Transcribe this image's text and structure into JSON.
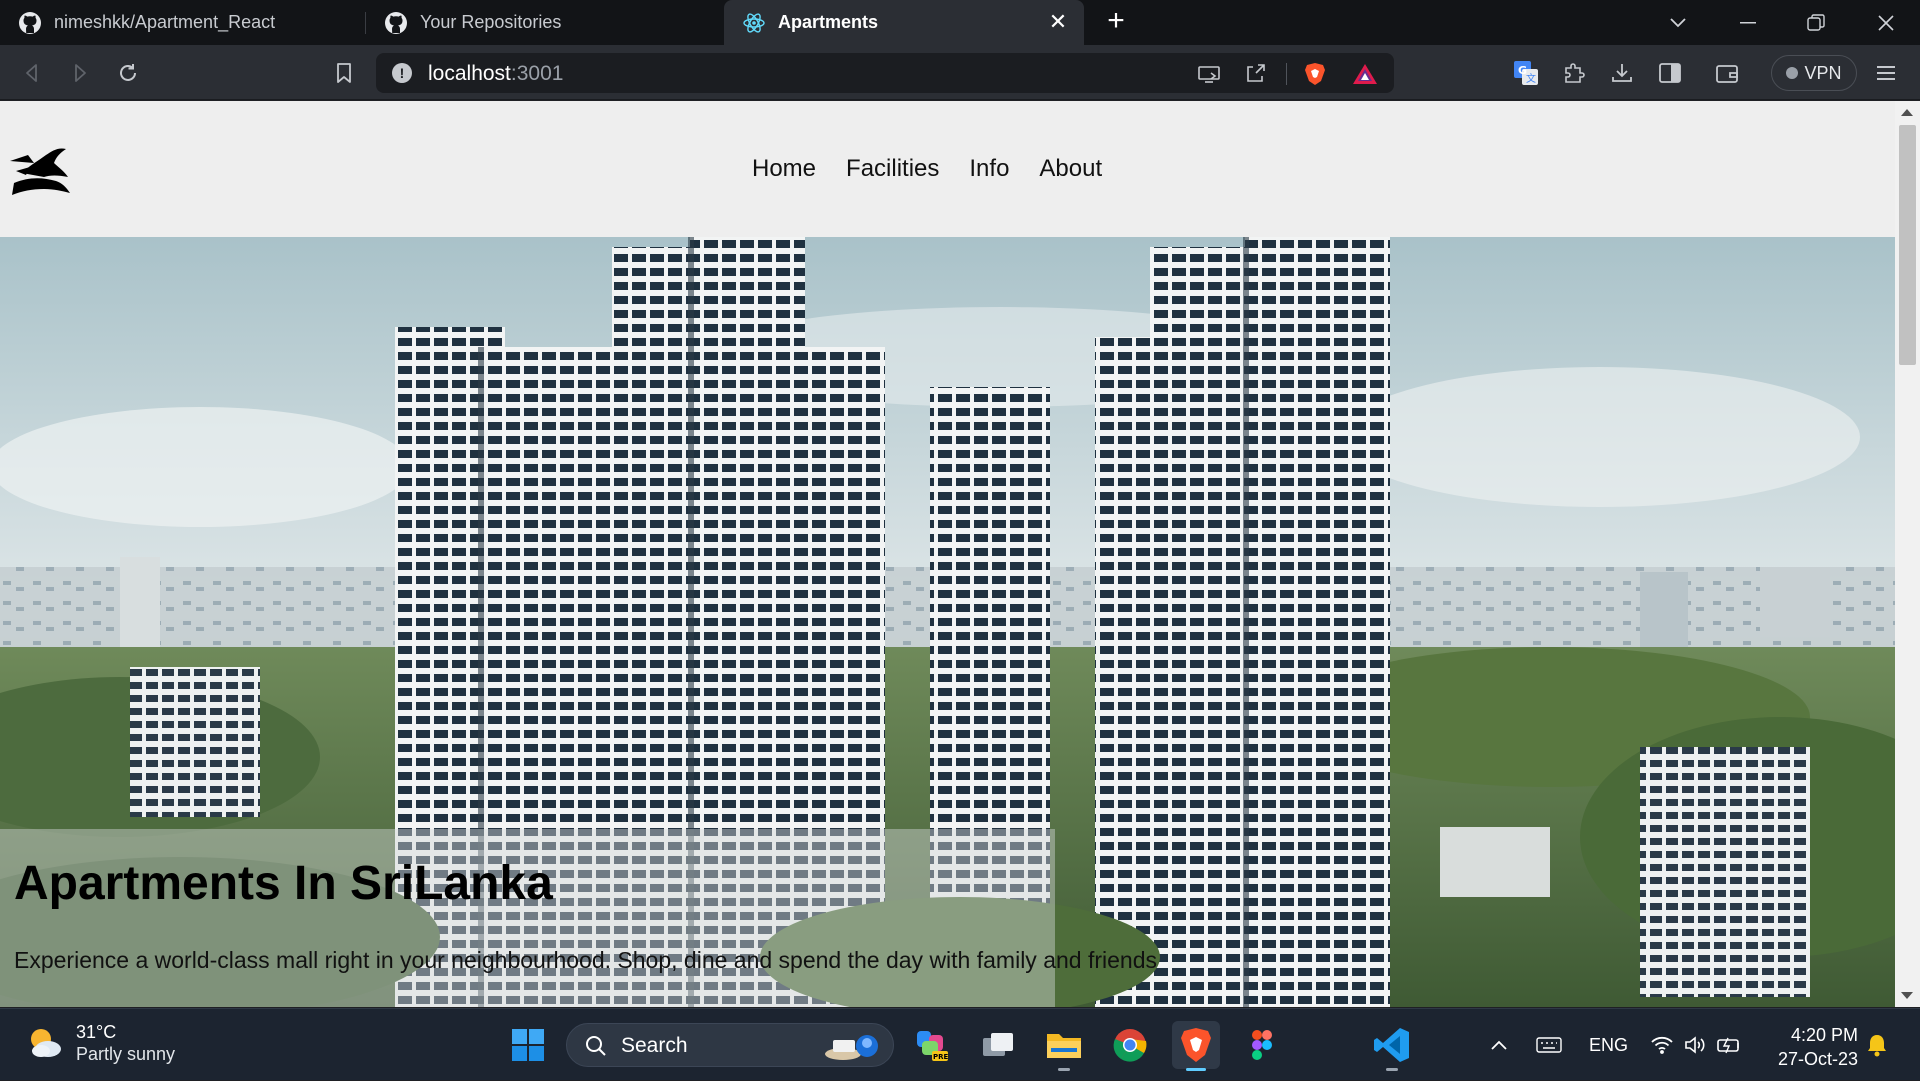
{
  "browser": {
    "tabs": [
      {
        "title": "nimeshkk/Apartment_React",
        "icon": "github-icon",
        "active": false
      },
      {
        "title": "Your Repositories",
        "icon": "github-icon",
        "active": false
      },
      {
        "title": "Apartments",
        "icon": "react-icon",
        "active": true
      }
    ],
    "url_host": "localhost",
    "url_port": ":3001",
    "vpn_label": "VPN"
  },
  "page": {
    "nav": [
      "Home",
      "Facilities",
      "Info",
      "About"
    ],
    "hero": {
      "title": "Apartments In SriLanka",
      "text": "Experience a world-class mall right in your neighbourhood. Shop, dine and spend the day with family and friends"
    }
  },
  "taskbar": {
    "weather_temp": "31°C",
    "weather_desc": "Partly sunny",
    "search_label": "Search",
    "language": "ENG",
    "time": "4:20 PM",
    "date": "27-Oct-23"
  },
  "colors": {
    "chrome_bg": "#2b2e34",
    "tabstrip_bg": "#121417",
    "page_bg": "#eeeeee",
    "taskbar_bg": "#1c2430",
    "brave_orange": "#fb542b",
    "accent_blue": "#60cdff"
  }
}
